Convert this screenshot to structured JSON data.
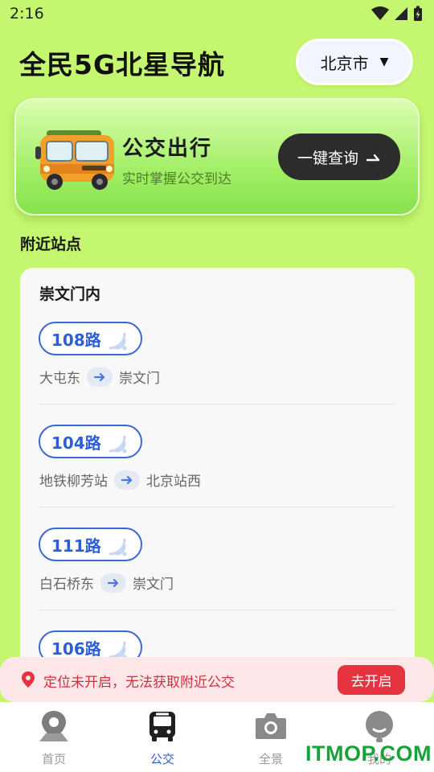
{
  "status_bar": {
    "time": "2:16"
  },
  "header": {
    "title": "全民5G北星导航",
    "city": "北京市",
    "city_caret": "▼"
  },
  "banner": {
    "title": "公交出行",
    "subtitle": "实时掌握公交到达",
    "button_label": "一键查询"
  },
  "nearby": {
    "section_title": "附近站点",
    "station_name": "崇文门内",
    "routes": [
      {
        "name": "108路",
        "from": "大屯东",
        "to": "崇文门"
      },
      {
        "name": "104路",
        "from": "地铁柳芳站",
        "to": "北京站西"
      },
      {
        "name": "111路",
        "from": "白石桥东",
        "to": "崇文门"
      },
      {
        "name": "106路",
        "from": "",
        "to": ""
      }
    ]
  },
  "toast": {
    "message": "定位未开启，无法获取附近公交",
    "button_label": "去开启"
  },
  "bottom_nav": {
    "items": [
      {
        "label": "首页",
        "icon": "location-pin-icon",
        "active": false
      },
      {
        "label": "公交",
        "icon": "bus-icon",
        "active": true
      },
      {
        "label": "全景",
        "icon": "camera-icon",
        "active": false
      },
      {
        "label": "我的",
        "icon": "profile-icon",
        "active": false
      }
    ]
  },
  "watermark": "ITMOP.COM",
  "colors": {
    "background": "#c4f76f",
    "accent_blue": "#2c5fd6",
    "alert_red": "#e5333f",
    "dark_button": "#2c2c2c"
  }
}
